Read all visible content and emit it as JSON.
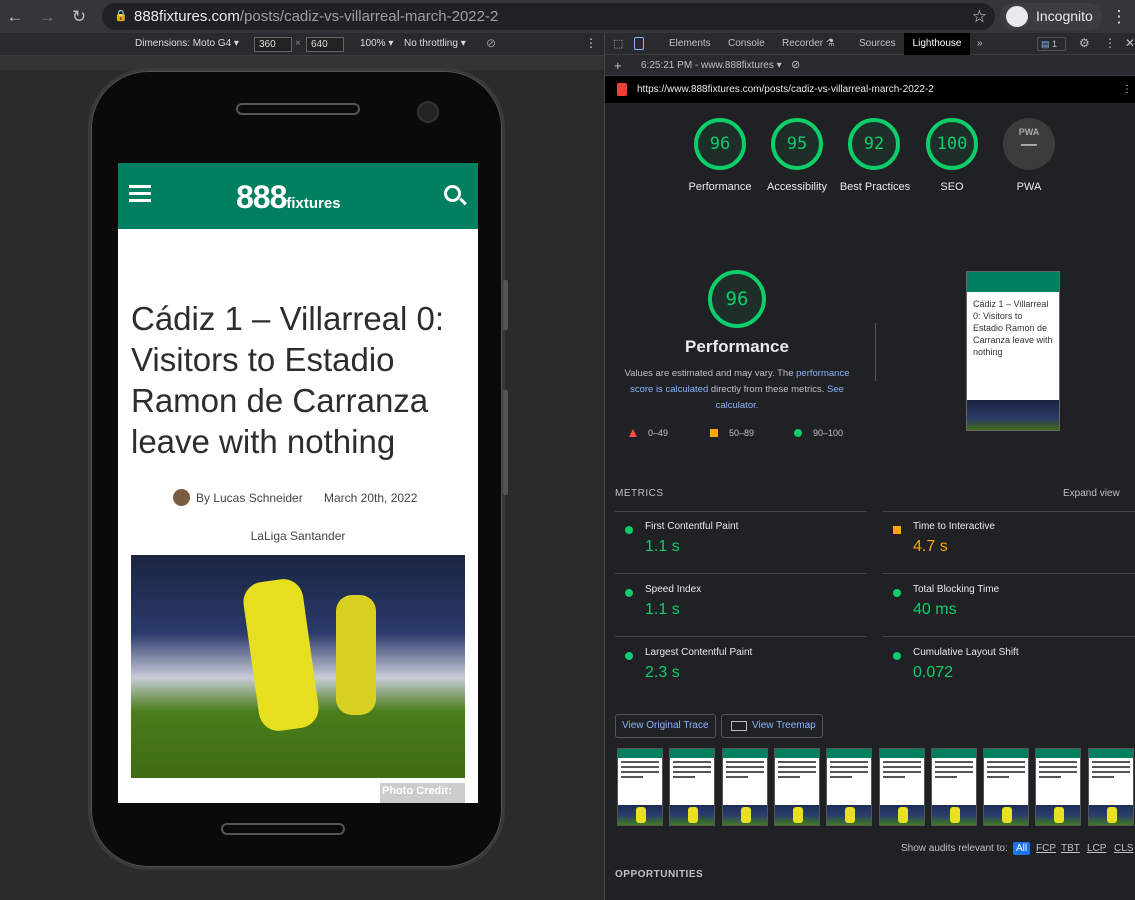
{
  "browser": {
    "url_domain": "888fixtures.com",
    "url_path": "/posts/cadiz-vs-villarreal-march-2022-2",
    "profile": "Incognito"
  },
  "device_toolbar": {
    "dimensions_label": "Dimensions: Moto G4",
    "width": "360",
    "height": "640",
    "times": "×",
    "zoom": "100%",
    "throttling": "No throttling"
  },
  "page": {
    "logo": "888",
    "logo_suffix": "fixtures",
    "title": "Cádiz 1 – Villarreal 0: Visitors to Estadio Ramon de Carranza leave with nothing",
    "byline": "By Lucas Schneider",
    "date": "March 20th, 2022",
    "category": "LaLiga Santander",
    "photo_credit": "Photo Credit:"
  },
  "devtools": {
    "tabs": [
      "Elements",
      "Console",
      "Recorder",
      "Sources",
      "Lighthouse"
    ],
    "active_tab": "Lighthouse",
    "issues_count": "1",
    "report_select": "6:25:21 PM - www.888fixtures",
    "report_url": "https://www.888fixtures.com/posts/cadiz-vs-villarreal-march-2022-2",
    "scores": [
      {
        "label": "Performance",
        "value": "96"
      },
      {
        "label": "Accessibility",
        "value": "95"
      },
      {
        "label": "Best Practices",
        "value": "92"
      },
      {
        "label": "SEO",
        "value": "100"
      },
      {
        "label": "PWA",
        "value": "—"
      }
    ],
    "pwa_badge": "PWA",
    "perf": {
      "score": "96",
      "title": "Performance",
      "desc_1": "Values are estimated and may vary. The ",
      "link_1": "performance score is calculated",
      "desc_2": " directly from these metrics. ",
      "link_2": "See calculator.",
      "legend": [
        "0–49",
        "50–89",
        "90–100"
      ]
    },
    "metrics_label": "METRICS",
    "expand_view": "Expand view",
    "metrics": [
      {
        "name": "First Contentful Paint",
        "value": "1.1 s",
        "status": "pass"
      },
      {
        "name": "Time to Interactive",
        "value": "4.7 s",
        "status": "average"
      },
      {
        "name": "Speed Index",
        "value": "1.1 s",
        "status": "pass"
      },
      {
        "name": "Total Blocking Time",
        "value": "40 ms",
        "status": "pass"
      },
      {
        "name": "Largest Contentful Paint",
        "value": "2.3 s",
        "status": "pass"
      },
      {
        "name": "Cumulative Layout Shift",
        "value": "0.072",
        "status": "pass"
      }
    ],
    "view_trace": "View Original Trace",
    "view_treemap": "View Treemap",
    "filter_label": "Show audits relevant to:",
    "filters": [
      "All",
      "FCP",
      "TBT",
      "LCP",
      "CLS"
    ],
    "opportunities": "OPPORTUNITIES",
    "colors": {
      "pass": "#0cce6b",
      "average": "#ffa400",
      "fail": "#ff4e42",
      "brand": "#008060"
    }
  }
}
